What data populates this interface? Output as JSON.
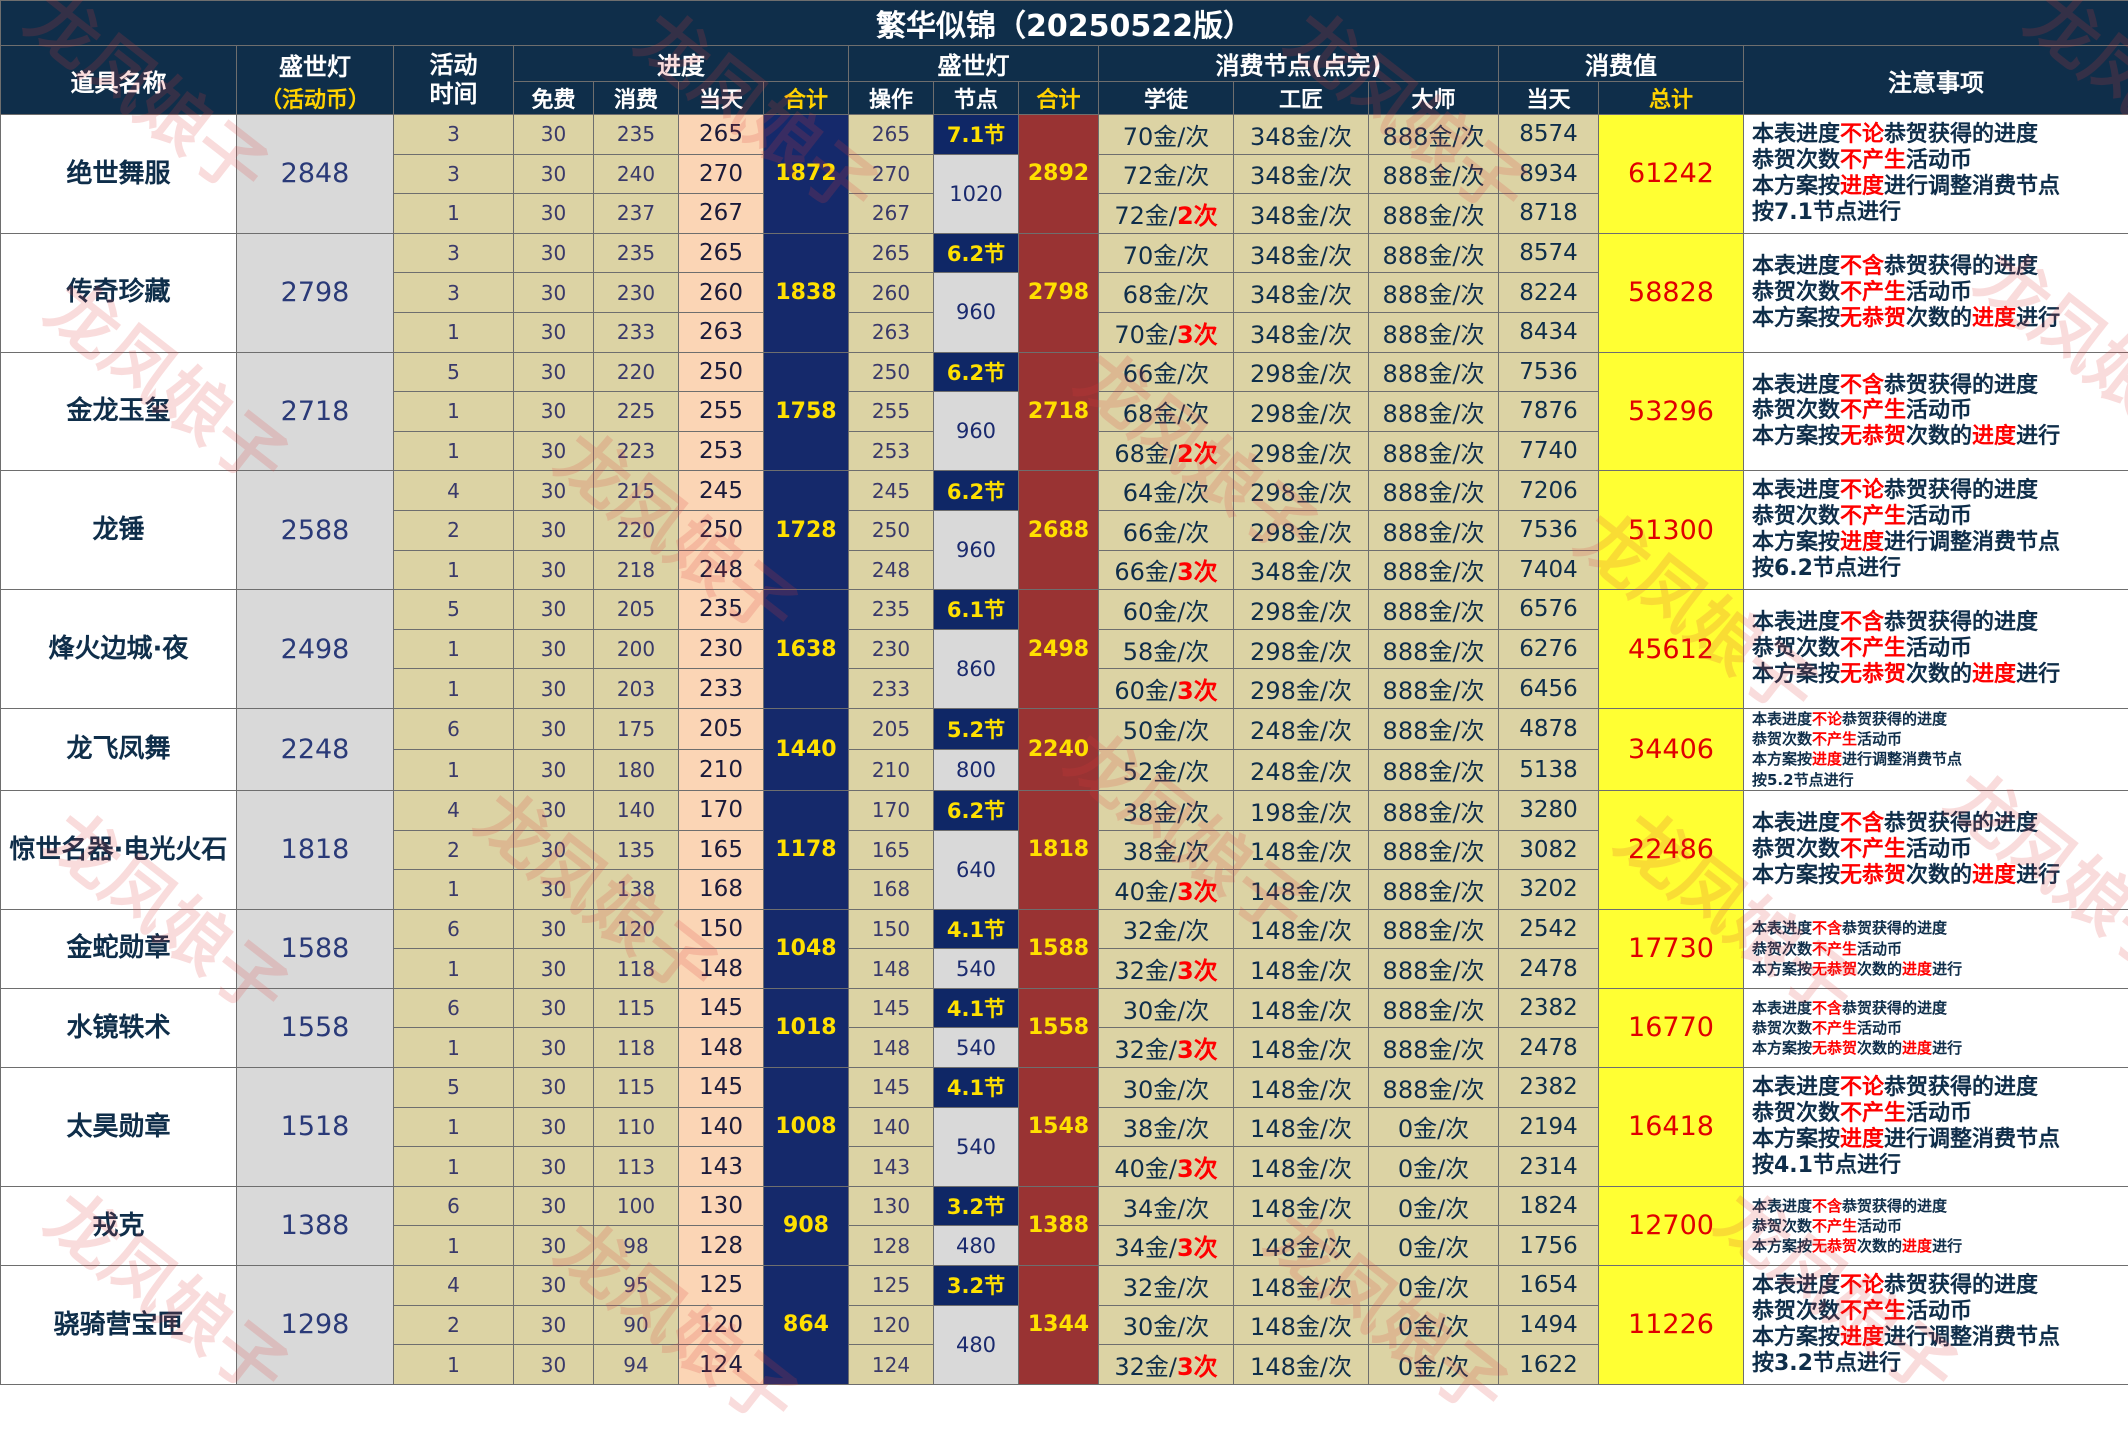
{
  "title": "繁华似锦（20250522版）",
  "header": {
    "item_name": "道具名称",
    "lantern": "盛世灯",
    "lantern_sub": "（活动币）",
    "activity_time_l1": "活动",
    "activity_time_l2": "时间",
    "progress": "进度",
    "progress_free": "免费",
    "progress_spend": "消费",
    "progress_day": "当天",
    "progress_total": "合计",
    "lantern2": "盛世灯",
    "lantern2_op": "操作",
    "lantern2_node": "节点",
    "lantern2_total": "合计",
    "nodes": "消费节点(点完)",
    "nodes_apprentice": "学徒",
    "nodes_craftsman": "工匠",
    "nodes_master": "大师",
    "value": "消费值",
    "value_day": "当天",
    "value_total": "总计",
    "notes": "注意事项"
  },
  "watermark": "龙凤娘子",
  "items": [
    {
      "name": "绝世舞服",
      "lantern": "2848",
      "ptotal": "1872",
      "node": "7.1节",
      "jiedian": "1020",
      "ltotal": "2892",
      "vtotal": "61242",
      "rows": [
        {
          "t": "3",
          "f": "30",
          "s": "235",
          "d": "265",
          "op": "265",
          "a": "70金/次",
          "ar": "",
          "c": "348金/次",
          "m": "888金/次",
          "v": "8574"
        },
        {
          "t": "3",
          "f": "30",
          "s": "240",
          "d": "270",
          "op": "270",
          "a": "72金/次",
          "ar": "",
          "c": "348金/次",
          "m": "888金/次",
          "v": "8934"
        },
        {
          "t": "1",
          "f": "30",
          "s": "237",
          "d": "267",
          "op": "267",
          "a": "72金/",
          "ar": "2次",
          "c": "348金/次",
          "m": "888金/次",
          "v": "8718"
        }
      ],
      "notes": [
        [
          [
            "本表进度",
            ""
          ],
          [
            "不论",
            "r"
          ],
          [
            "恭贺获得的进度",
            ""
          ]
        ],
        [
          [
            "恭贺次数",
            ""
          ],
          [
            "不产生",
            "r"
          ],
          [
            "活动币",
            ""
          ]
        ],
        [
          [
            "本方案按",
            ""
          ],
          [
            "进度",
            "r"
          ],
          [
            "进行调整消费节点",
            ""
          ]
        ],
        [
          [
            "按7.1节点进行",
            ""
          ]
        ]
      ]
    },
    {
      "name": "传奇珍藏",
      "lantern": "2798",
      "ptotal": "1838",
      "node": "6.2节",
      "jiedian": "960",
      "ltotal": "2798",
      "vtotal": "58828",
      "rows": [
        {
          "t": "3",
          "f": "30",
          "s": "235",
          "d": "265",
          "op": "265",
          "a": "70金/次",
          "ar": "",
          "c": "348金/次",
          "m": "888金/次",
          "v": "8574"
        },
        {
          "t": "3",
          "f": "30",
          "s": "230",
          "d": "260",
          "op": "260",
          "a": "68金/次",
          "ar": "",
          "c": "348金/次",
          "m": "888金/次",
          "v": "8224"
        },
        {
          "t": "1",
          "f": "30",
          "s": "233",
          "d": "263",
          "op": "263",
          "a": "70金/",
          "ar": "3次",
          "c": "348金/次",
          "m": "888金/次",
          "v": "8434"
        }
      ],
      "notes": [
        [
          [
            "本表进度",
            ""
          ],
          [
            "不含",
            "r"
          ],
          [
            "恭贺获得的进度",
            ""
          ]
        ],
        [
          [
            "恭贺次数",
            ""
          ],
          [
            "不产生",
            "r"
          ],
          [
            "活动币",
            ""
          ]
        ],
        [
          [
            "本方案按",
            ""
          ],
          [
            "无恭贺",
            "r"
          ],
          [
            "次数的",
            ""
          ],
          [
            "进度",
            "r"
          ],
          [
            "进行",
            ""
          ]
        ]
      ]
    },
    {
      "name": "金龙玉玺",
      "lantern": "2718",
      "ptotal": "1758",
      "node": "6.2节",
      "jiedian": "960",
      "ltotal": "2718",
      "vtotal": "53296",
      "rows": [
        {
          "t": "5",
          "f": "30",
          "s": "220",
          "d": "250",
          "op": "250",
          "a": "66金/次",
          "ar": "",
          "c": "298金/次",
          "m": "888金/次",
          "v": "7536"
        },
        {
          "t": "1",
          "f": "30",
          "s": "225",
          "d": "255",
          "op": "255",
          "a": "68金/次",
          "ar": "",
          "c": "298金/次",
          "m": "888金/次",
          "v": "7876"
        },
        {
          "t": "1",
          "f": "30",
          "s": "223",
          "d": "253",
          "op": "253",
          "a": "68金/",
          "ar": "2次",
          "c": "298金/次",
          "m": "888金/次",
          "v": "7740"
        }
      ],
      "notes": [
        [
          [
            "本表进度",
            ""
          ],
          [
            "不含",
            "r"
          ],
          [
            "恭贺获得的进度",
            ""
          ]
        ],
        [
          [
            "恭贺次数",
            ""
          ],
          [
            "不产生",
            "r"
          ],
          [
            "活动币",
            ""
          ]
        ],
        [
          [
            "本方案按",
            ""
          ],
          [
            "无恭贺",
            "r"
          ],
          [
            "次数的",
            ""
          ],
          [
            "进度",
            "r"
          ],
          [
            "进行",
            ""
          ]
        ]
      ]
    },
    {
      "name": "龙锤",
      "lantern": "2588",
      "ptotal": "1728",
      "node": "6.2节",
      "jiedian": "960",
      "ltotal": "2688",
      "vtotal": "51300",
      "rows": [
        {
          "t": "4",
          "f": "30",
          "s": "215",
          "d": "245",
          "op": "245",
          "a": "64金/次",
          "ar": "",
          "c": "298金/次",
          "m": "888金/次",
          "v": "7206"
        },
        {
          "t": "2",
          "f": "30",
          "s": "220",
          "d": "250",
          "op": "250",
          "a": "66金/次",
          "ar": "",
          "c": "298金/次",
          "m": "888金/次",
          "v": "7536"
        },
        {
          "t": "1",
          "f": "30",
          "s": "218",
          "d": "248",
          "op": "248",
          "a": "66金/",
          "ar": "3次",
          "c": "348金/次",
          "m": "888金/次",
          "v": "7404"
        }
      ],
      "notes": [
        [
          [
            "本表进度",
            ""
          ],
          [
            "不论",
            "r"
          ],
          [
            "恭贺获得的进度",
            ""
          ]
        ],
        [
          [
            "恭贺次数",
            ""
          ],
          [
            "不产生",
            "r"
          ],
          [
            "活动币",
            ""
          ]
        ],
        [
          [
            "本方案按",
            ""
          ],
          [
            "进度",
            "r"
          ],
          [
            "进行调整消费节点",
            ""
          ]
        ],
        [
          [
            "按6.2节点进行",
            ""
          ]
        ]
      ]
    },
    {
      "name": "烽火边城·夜",
      "lantern": "2498",
      "ptotal": "1638",
      "node": "6.1节",
      "jiedian": "860",
      "ltotal": "2498",
      "vtotal": "45612",
      "rows": [
        {
          "t": "5",
          "f": "30",
          "s": "205",
          "d": "235",
          "op": "235",
          "a": "60金/次",
          "ar": "",
          "c": "298金/次",
          "m": "888金/次",
          "v": "6576"
        },
        {
          "t": "1",
          "f": "30",
          "s": "200",
          "d": "230",
          "op": "230",
          "a": "58金/次",
          "ar": "",
          "c": "298金/次",
          "m": "888金/次",
          "v": "6276"
        },
        {
          "t": "1",
          "f": "30",
          "s": "203",
          "d": "233",
          "op": "233",
          "a": "60金/",
          "ar": "3次",
          "c": "298金/次",
          "m": "888金/次",
          "v": "6456"
        }
      ],
      "notes": [
        [
          [
            "本表进度",
            ""
          ],
          [
            "不含",
            "r"
          ],
          [
            "恭贺获得的进度",
            ""
          ]
        ],
        [
          [
            "恭贺次数",
            ""
          ],
          [
            "不产生",
            "r"
          ],
          [
            "活动币",
            ""
          ]
        ],
        [
          [
            "本方案按",
            ""
          ],
          [
            "无恭贺",
            "r"
          ],
          [
            "次数的",
            ""
          ],
          [
            "进度",
            "r"
          ],
          [
            "进行",
            ""
          ]
        ]
      ]
    },
    {
      "name": "龙飞凤舞",
      "lantern": "2248",
      "ptotal": "1440",
      "node": "5.2节",
      "jiedian": "800",
      "ltotal": "2240",
      "vtotal": "34406",
      "small": true,
      "rows": [
        {
          "t": "6",
          "f": "30",
          "s": "175",
          "d": "205",
          "op": "205",
          "a": "50金/次",
          "ar": "",
          "c": "248金/次",
          "m": "888金/次",
          "v": "4878"
        },
        {
          "t": "1",
          "f": "30",
          "s": "180",
          "d": "210",
          "op": "210",
          "a": "52金/次",
          "ar": "",
          "c": "248金/次",
          "m": "888金/次",
          "v": "5138"
        }
      ],
      "notes": [
        [
          [
            "本表进度",
            ""
          ],
          [
            "不论",
            "r"
          ],
          [
            "恭贺获得的进度",
            ""
          ]
        ],
        [
          [
            "恭贺次数",
            ""
          ],
          [
            "不产生",
            "r"
          ],
          [
            "活动币",
            ""
          ]
        ],
        [
          [
            "本方案按",
            ""
          ],
          [
            "进度",
            "r"
          ],
          [
            "进行调整消费节点",
            ""
          ]
        ],
        [
          [
            "按5.2节点进行",
            ""
          ]
        ]
      ]
    },
    {
      "name": "惊世名器·电光火石",
      "lantern": "1818",
      "ptotal": "1178",
      "node": "6.2节",
      "jiedian": "640",
      "ltotal": "1818",
      "vtotal": "22486",
      "rows": [
        {
          "t": "4",
          "f": "30",
          "s": "140",
          "d": "170",
          "op": "170",
          "a": "38金/次",
          "ar": "",
          "c": "198金/次",
          "m": "888金/次",
          "v": "3280"
        },
        {
          "t": "2",
          "f": "30",
          "s": "135",
          "d": "165",
          "op": "165",
          "a": "38金/次",
          "ar": "",
          "c": "148金/次",
          "m": "888金/次",
          "v": "3082"
        },
        {
          "t": "1",
          "f": "30",
          "s": "138",
          "d": "168",
          "op": "168",
          "a": "40金/",
          "ar": "3次",
          "c": "148金/次",
          "m": "888金/次",
          "v": "3202"
        }
      ],
      "notes": [
        [
          [
            "本表进度",
            ""
          ],
          [
            "不含",
            "r"
          ],
          [
            "恭贺获得的进度",
            ""
          ]
        ],
        [
          [
            "恭贺次数",
            ""
          ],
          [
            "不产生",
            "r"
          ],
          [
            "活动币",
            ""
          ]
        ],
        [
          [
            "本方案按",
            ""
          ],
          [
            "无恭贺",
            "r"
          ],
          [
            "次数的",
            ""
          ],
          [
            "进度",
            "r"
          ],
          [
            "进行",
            ""
          ]
        ]
      ]
    },
    {
      "name": "金蛇勋章",
      "lantern": "1588",
      "ptotal": "1048",
      "node": "4.1节",
      "jiedian": "540",
      "ltotal": "1588",
      "vtotal": "17730",
      "small": true,
      "rows": [
        {
          "t": "6",
          "f": "30",
          "s": "120",
          "d": "150",
          "op": "150",
          "a": "32金/次",
          "ar": "",
          "c": "148金/次",
          "m": "888金/次",
          "v": "2542"
        },
        {
          "t": "1",
          "f": "30",
          "s": "118",
          "d": "148",
          "op": "148",
          "a": "32金/",
          "ar": "3次",
          "c": "148金/次",
          "m": "888金/次",
          "v": "2478"
        }
      ],
      "notes": [
        [
          [
            "本表进度",
            ""
          ],
          [
            "不含",
            "r"
          ],
          [
            "恭贺获得的进度",
            ""
          ]
        ],
        [
          [
            "恭贺次数",
            ""
          ],
          [
            "不产生",
            "r"
          ],
          [
            "活动币",
            ""
          ]
        ],
        [
          [
            "本方案按",
            ""
          ],
          [
            "无恭贺",
            "r"
          ],
          [
            "次数的",
            ""
          ],
          [
            "进度",
            "r"
          ],
          [
            "进行",
            ""
          ]
        ]
      ]
    },
    {
      "name": "水镜轶术",
      "lantern": "1558",
      "ptotal": "1018",
      "node": "4.1节",
      "jiedian": "540",
      "ltotal": "1558",
      "vtotal": "16770",
      "small": true,
      "rows": [
        {
          "t": "6",
          "f": "30",
          "s": "115",
          "d": "145",
          "op": "145",
          "a": "30金/次",
          "ar": "",
          "c": "148金/次",
          "m": "888金/次",
          "v": "2382"
        },
        {
          "t": "1",
          "f": "30",
          "s": "118",
          "d": "148",
          "op": "148",
          "a": "32金/",
          "ar": "3次",
          "c": "148金/次",
          "m": "888金/次",
          "v": "2478"
        }
      ],
      "notes": [
        [
          [
            "本表进度",
            ""
          ],
          [
            "不含",
            "r"
          ],
          [
            "恭贺获得的进度",
            ""
          ]
        ],
        [
          [
            "恭贺次数",
            ""
          ],
          [
            "不产生",
            "r"
          ],
          [
            "活动币",
            ""
          ]
        ],
        [
          [
            "本方案按",
            ""
          ],
          [
            "无恭贺",
            "r"
          ],
          [
            "次数的",
            ""
          ],
          [
            "进度",
            "r"
          ],
          [
            "进行",
            ""
          ]
        ]
      ]
    },
    {
      "name": "太昊勋章",
      "lantern": "1518",
      "ptotal": "1008",
      "node": "4.1节",
      "jiedian": "540",
      "ltotal": "1548",
      "vtotal": "16418",
      "rows": [
        {
          "t": "5",
          "f": "30",
          "s": "115",
          "d": "145",
          "op": "145",
          "a": "30金/次",
          "ar": "",
          "c": "148金/次",
          "m": "888金/次",
          "v": "2382"
        },
        {
          "t": "1",
          "f": "30",
          "s": "110",
          "d": "140",
          "op": "140",
          "a": "38金/次",
          "ar": "",
          "c": "148金/次",
          "m": "0金/次",
          "v": "2194"
        },
        {
          "t": "1",
          "f": "30",
          "s": "113",
          "d": "143",
          "op": "143",
          "a": "40金/",
          "ar": "3次",
          "c": "148金/次",
          "m": "0金/次",
          "v": "2314"
        }
      ],
      "notes": [
        [
          [
            "本表进度",
            ""
          ],
          [
            "不论",
            "r"
          ],
          [
            "恭贺获得的进度",
            ""
          ]
        ],
        [
          [
            "恭贺次数",
            ""
          ],
          [
            "不产生",
            "r"
          ],
          [
            "活动币",
            ""
          ]
        ],
        [
          [
            "本方案按",
            ""
          ],
          [
            "进度",
            "r"
          ],
          [
            "进行调整消费节点",
            ""
          ]
        ],
        [
          [
            "按4.1节点进行",
            ""
          ]
        ]
      ]
    },
    {
      "name": "戎克",
      "lantern": "1388",
      "ptotal": "908",
      "node": "3.2节",
      "jiedian": "480",
      "ltotal": "1388",
      "vtotal": "12700",
      "small": true,
      "rows": [
        {
          "t": "6",
          "f": "30",
          "s": "100",
          "d": "130",
          "op": "130",
          "a": "34金/次",
          "ar": "",
          "c": "148金/次",
          "m": "0金/次",
          "v": "1824"
        },
        {
          "t": "1",
          "f": "30",
          "s": "98",
          "d": "128",
          "op": "128",
          "a": "34金/",
          "ar": "3次",
          "c": "148金/次",
          "m": "0金/次",
          "v": "1756"
        }
      ],
      "notes": [
        [
          [
            "本表进度",
            ""
          ],
          [
            "不含",
            "r"
          ],
          [
            "恭贺获得的进度",
            ""
          ]
        ],
        [
          [
            "恭贺次数",
            ""
          ],
          [
            "不产生",
            "r"
          ],
          [
            "活动币",
            ""
          ]
        ],
        [
          [
            "本方案按",
            ""
          ],
          [
            "无恭贺",
            "r"
          ],
          [
            "次数的",
            ""
          ],
          [
            "进度",
            "r"
          ],
          [
            "进行",
            ""
          ]
        ]
      ]
    },
    {
      "name": "骁骑营宝匣",
      "lantern": "1298",
      "ptotal": "864",
      "node": "3.2节",
      "jiedian": "480",
      "ltotal": "1344",
      "vtotal": "11226",
      "rows": [
        {
          "t": "4",
          "f": "30",
          "s": "95",
          "d": "125",
          "op": "125",
          "a": "32金/次",
          "ar": "",
          "c": "148金/次",
          "m": "0金/次",
          "v": "1654"
        },
        {
          "t": "2",
          "f": "30",
          "s": "90",
          "d": "120",
          "op": "120",
          "a": "30金/次",
          "ar": "",
          "c": "148金/次",
          "m": "0金/次",
          "v": "1494"
        },
        {
          "t": "1",
          "f": "30",
          "s": "94",
          "d": "124",
          "op": "124",
          "a": "32金/",
          "ar": "3次",
          "c": "148金/次",
          "m": "0金/次",
          "v": "1622"
        }
      ],
      "notes": [
        [
          [
            "本表进度",
            ""
          ],
          [
            "不论",
            "r"
          ],
          [
            "恭贺获得的进度",
            ""
          ]
        ],
        [
          [
            "恭贺次数",
            ""
          ],
          [
            "不产生",
            "r"
          ],
          [
            "活动币",
            ""
          ]
        ],
        [
          [
            "本方案按",
            ""
          ],
          [
            "进度",
            "r"
          ],
          [
            "进行调整消费节点",
            ""
          ]
        ],
        [
          [
            "按3.2节点进行",
            ""
          ]
        ]
      ]
    }
  ]
}
